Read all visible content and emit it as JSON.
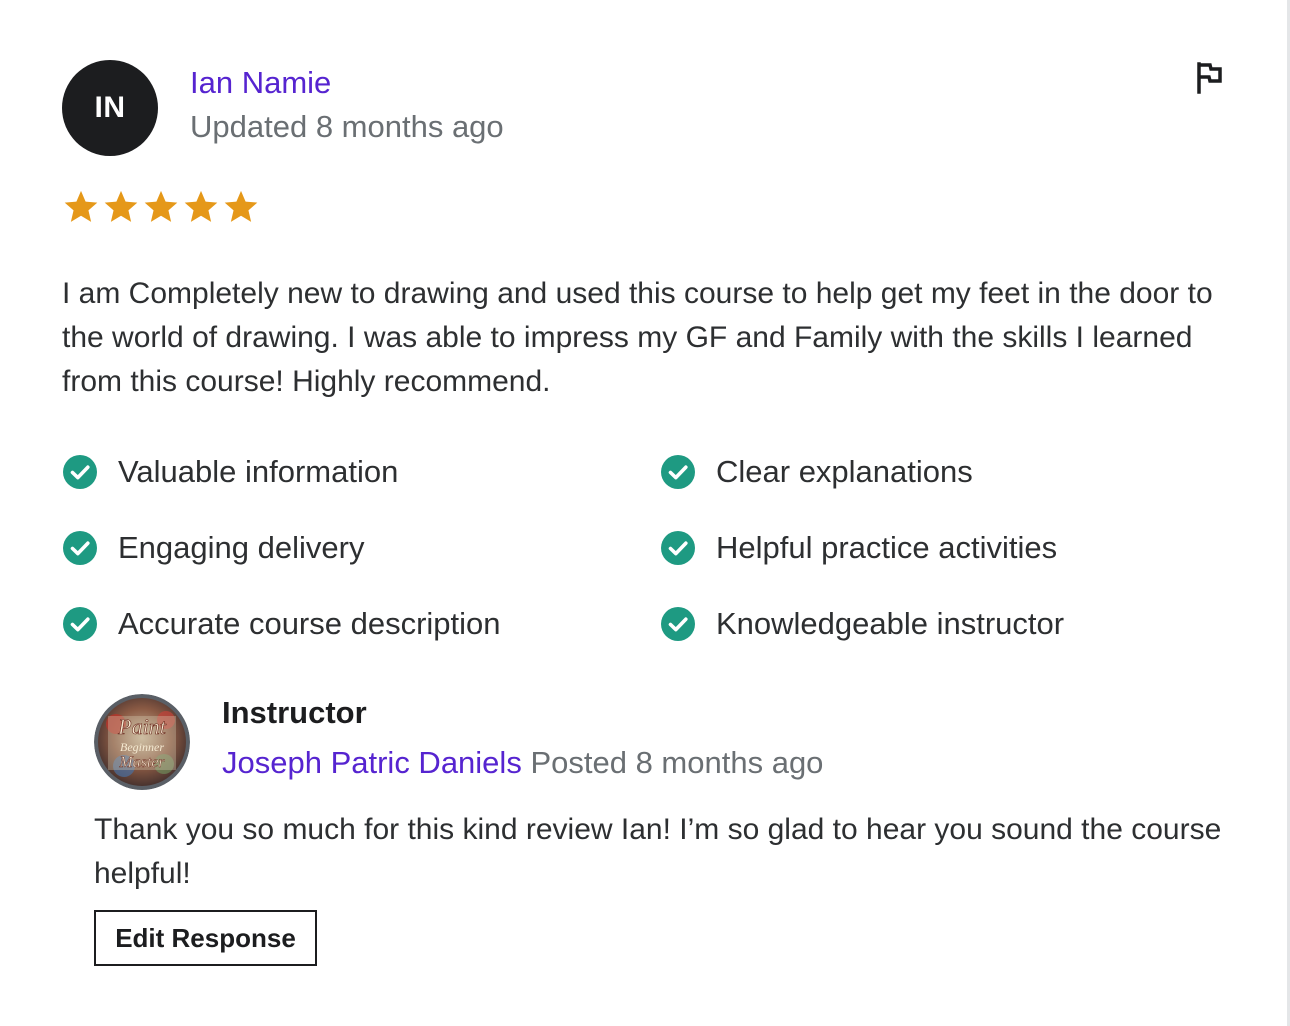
{
  "review": {
    "avatar_initials": "IN",
    "reviewer_name": "Ian Namie",
    "updated": "Updated 8 months ago",
    "rating": 5,
    "text": "I am Completely new to drawing and used this course to help get my feet in the door to the world of drawing. I was able to impress my GF and Family with the skills I learned from this course! Highly recommend.",
    "flag_icon": "flag-icon",
    "features": [
      {
        "label": "Valuable information"
      },
      {
        "label": "Clear explanations"
      },
      {
        "label": "Engaging delivery"
      },
      {
        "label": "Helpful practice activities"
      },
      {
        "label": "Accurate course description"
      },
      {
        "label": "Knowledgeable instructor"
      }
    ]
  },
  "response": {
    "role": "Instructor",
    "instructor_name": "Joseph Patric Daniels",
    "posted": "Posted 8 months ago",
    "avatar_text": [
      "Paint",
      "Beginner",
      "Master"
    ],
    "text": "Thank you so much for this kind review Ian! I’m so glad to hear you sound the course helpful!",
    "edit_button": "Edit Response"
  },
  "colors": {
    "accent_purple": "#5624d0",
    "star": "#e59819",
    "check": "#1e9a82",
    "text": "#2d2f31",
    "muted": "#6a6f73"
  }
}
